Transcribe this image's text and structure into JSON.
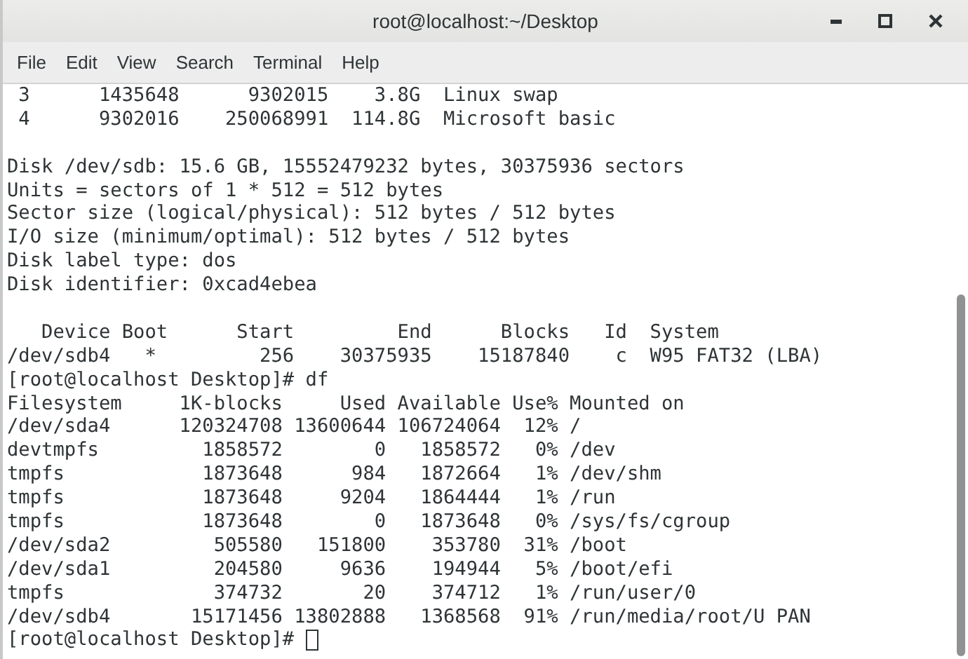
{
  "window": {
    "title": "root@localhost:~/Desktop"
  },
  "menu": [
    "File",
    "Edit",
    "View",
    "Search",
    "Terminal",
    "Help"
  ],
  "terminal": {
    "blocks": [
      [
        " 3      1435648      9302015    3.8G  Linux swap",
        " 4      9302016    250068991  114.8G  Microsoft basic"
      ],
      [
        "Disk /dev/sdb: 15.6 GB, 15552479232 bytes, 30375936 sectors",
        "Units = sectors of 1 * 512 = 512 bytes",
        "Sector size (logical/physical): 512 bytes / 512 bytes",
        "I/O size (minimum/optimal): 512 bytes / 512 bytes",
        "Disk label type: dos",
        "Disk identifier: 0xcad4ebea"
      ],
      [
        "   Device Boot      Start         End      Blocks   Id  System",
        "/dev/sdb4   *         256    30375935    15187840    c  W95 FAT32 (LBA)",
        "[root@localhost Desktop]# df",
        "Filesystem     1K-blocks     Used Available Use% Mounted on",
        "/dev/sda4      120324708 13600644 106724064  12% /",
        "devtmpfs         1858572        0   1858572   0% /dev",
        "tmpfs            1873648      984   1872664   1% /dev/shm",
        "tmpfs            1873648     9204   1864444   1% /run",
        "tmpfs            1873648        0   1873648   0% /sys/fs/cgroup",
        "/dev/sda2         505580   151800    353780  31% /boot",
        "/dev/sda1         204580     9636    194944   5% /boot/efi",
        "tmpfs             374732       20    374712   1% /run/user/0",
        "/dev/sdb4       15171456 13802888   1368568  91% /run/media/root/U PAN"
      ]
    ],
    "prompt": "[root@localhost Desktop]#"
  }
}
